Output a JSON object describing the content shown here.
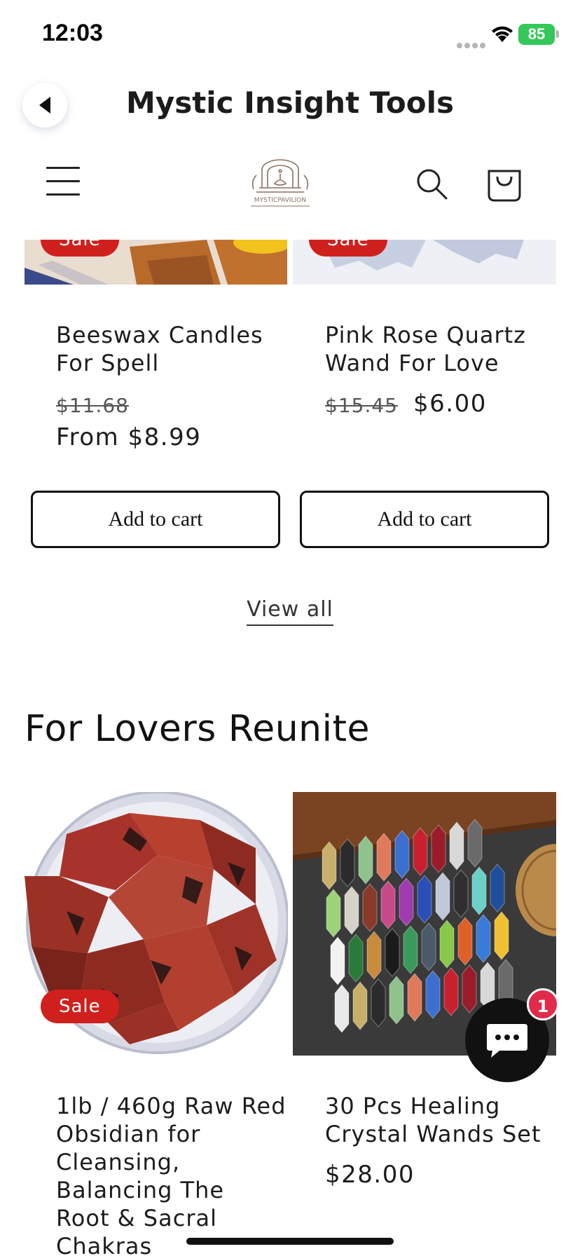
{
  "status_bar": {
    "time": "12:03",
    "battery": "85"
  },
  "header": {
    "title": "Mystic Insight Tools"
  },
  "store_nav": {
    "logo_text": "MYSTICPAVILION"
  },
  "top_products": [
    {
      "badge": "Sale",
      "title_line1": "Beeswax Candles",
      "title_line2": "For Spell",
      "price_old": "$11.68",
      "price_new": "From $8.99",
      "button": "Add to cart"
    },
    {
      "badge": "Sale",
      "title_line1": "Pink Rose Quartz",
      "title_line2": "Wand For Love",
      "price_old": "$15.45",
      "price_new": "$6.00",
      "button": "Add to cart"
    }
  ],
  "view_all": "View all",
  "section": {
    "heading": "For Lovers Reunite",
    "products": [
      {
        "badge": "Sale",
        "title_lines": [
          "1lb / 460g Raw Red",
          "Obsidian for",
          "Cleansing,",
          "Balancing The",
          "Root & Sacral",
          "Chakras"
        ]
      },
      {
        "title_lines": [
          "30 Pcs Healing",
          "Crystal Wands Set"
        ],
        "price": "$28.00"
      }
    ]
  },
  "chat": {
    "badge_count": "1"
  },
  "colors": {
    "sale": "#d0201d",
    "battery": "#34c759",
    "chat_badge": "#e12a4c"
  },
  "icons": [
    "back-arrow-icon",
    "menu-icon",
    "search-icon",
    "cart-icon",
    "chat-icon",
    "wifi-icon"
  ]
}
